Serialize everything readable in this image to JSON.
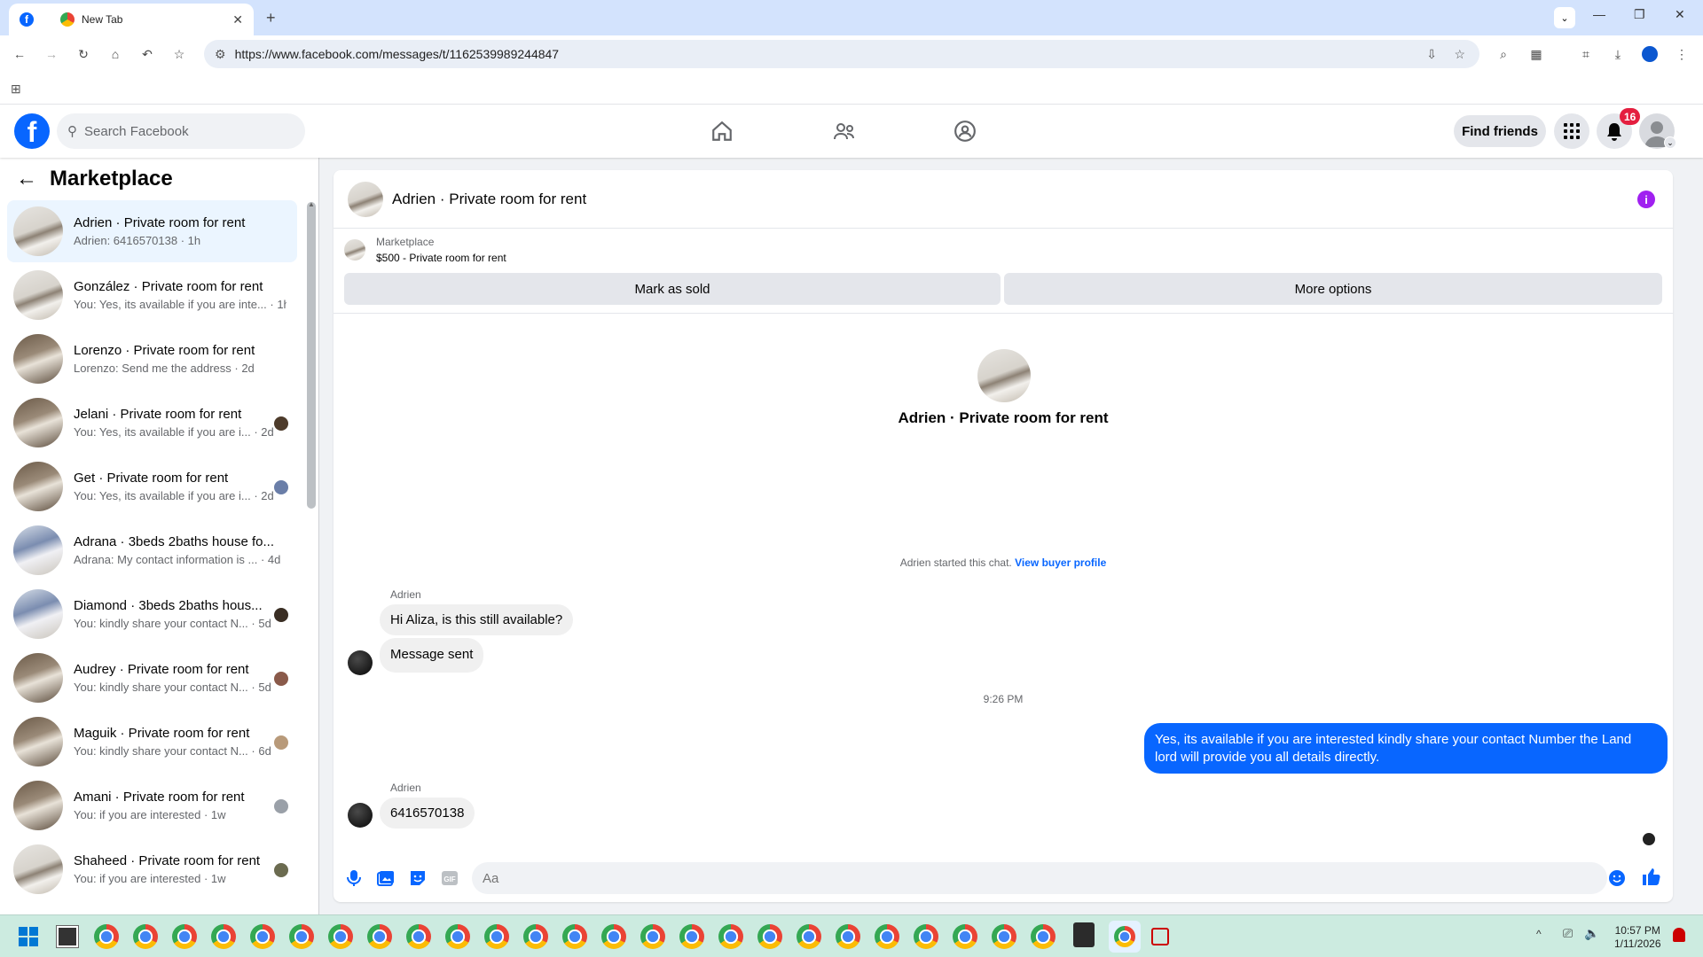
{
  "browser": {
    "tabs": [
      {
        "label": "",
        "icon": "facebook-icon",
        "active": true
      },
      {
        "label": "New Tab",
        "icon": "chrome-icon",
        "active": false
      }
    ],
    "url": "https://www.facebook.com/messages/t/1162539989244847"
  },
  "fb": {
    "search_placeholder": "Search Facebook",
    "find_friends": "Find friends",
    "notification_count": "16"
  },
  "sidebar": {
    "title": "Marketplace",
    "conversations": [
      {
        "name": "Adrien · Private room for rent",
        "preview": "Adrien: 6416570138 · 1h",
        "active": true
      },
      {
        "name": "González · Private room for rent",
        "preview": "You: Yes, its available if you are inte... · 1h"
      },
      {
        "name": "Lorenzo · Private room for rent",
        "preview": "Lorenzo: Send me the address · 2d"
      },
      {
        "name": "Jelani · Private room for rent",
        "preview": "You: Yes, its available if you are i... · 2d"
      },
      {
        "name": "Get · Private room for rent",
        "preview": "You: Yes, its available if you are i... · 2d"
      },
      {
        "name": "Adrana · 3beds 2baths house fo...",
        "preview": "Adrana: My contact information is ... · 4d"
      },
      {
        "name": "Diamond · 3beds 2baths hous...",
        "preview": "You: kindly share your contact N... · 5d"
      },
      {
        "name": "Audrey · Private room for rent",
        "preview": "You: kindly share your contact N... · 5d"
      },
      {
        "name": "Maguik · Private room for rent",
        "preview": "You: kindly share your contact N... · 6d"
      },
      {
        "name": "Amani · Private room for rent",
        "preview": "You: if you are interested · 1w"
      },
      {
        "name": "Shaheed · Private room for rent",
        "preview": "You: if you are interested · 1w"
      }
    ]
  },
  "chat": {
    "title": "Adrien · Private room for rent",
    "listing_label": "Marketplace",
    "listing_value": "$500 - Private room for rent",
    "mark_sold": "Mark as sold",
    "more_options": "More options",
    "center_name": "Adrien · Private room for rent",
    "started_text": "Adrien started this chat.",
    "view_profile": "View buyer profile",
    "sender1": "Adrien",
    "msg1": "Hi Aliza, is this still available?",
    "msg2": "Message sent",
    "timestamp": "9:26 PM",
    "my_msg": "Yes, its available if you are interested kindly share your contact Number the Land lord will provide you all details directly.",
    "sender2": "Adrien",
    "msg3": "6416570138",
    "input_placeholder": "Aa"
  },
  "taskbar": {
    "time": "10:57 PM",
    "date": "1/11/2026"
  }
}
